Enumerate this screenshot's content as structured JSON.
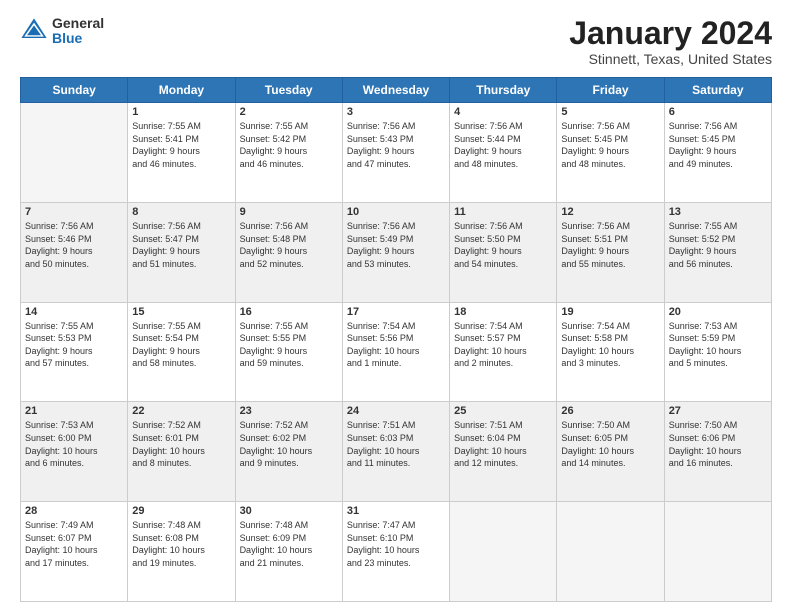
{
  "logo": {
    "general": "General",
    "blue": "Blue"
  },
  "title": "January 2024",
  "subtitle": "Stinnett, Texas, United States",
  "days_header": [
    "Sunday",
    "Monday",
    "Tuesday",
    "Wednesday",
    "Thursday",
    "Friday",
    "Saturday"
  ],
  "weeks": [
    [
      {
        "num": "",
        "empty": true
      },
      {
        "num": "1",
        "sunrise": "Sunrise: 7:55 AM",
        "sunset": "Sunset: 5:41 PM",
        "daylight": "Daylight: 9 hours and 46 minutes."
      },
      {
        "num": "2",
        "sunrise": "Sunrise: 7:55 AM",
        "sunset": "Sunset: 5:42 PM",
        "daylight": "Daylight: 9 hours and 46 minutes."
      },
      {
        "num": "3",
        "sunrise": "Sunrise: 7:56 AM",
        "sunset": "Sunset: 5:43 PM",
        "daylight": "Daylight: 9 hours and 47 minutes."
      },
      {
        "num": "4",
        "sunrise": "Sunrise: 7:56 AM",
        "sunset": "Sunset: 5:44 PM",
        "daylight": "Daylight: 9 hours and 48 minutes."
      },
      {
        "num": "5",
        "sunrise": "Sunrise: 7:56 AM",
        "sunset": "Sunset: 5:45 PM",
        "daylight": "Daylight: 9 hours and 48 minutes."
      },
      {
        "num": "6",
        "sunrise": "Sunrise: 7:56 AM",
        "sunset": "Sunset: 5:45 PM",
        "daylight": "Daylight: 9 hours and 49 minutes."
      }
    ],
    [
      {
        "num": "7",
        "sunrise": "Sunrise: 7:56 AM",
        "sunset": "Sunset: 5:46 PM",
        "daylight": "Daylight: 9 hours and 50 minutes."
      },
      {
        "num": "8",
        "sunrise": "Sunrise: 7:56 AM",
        "sunset": "Sunset: 5:47 PM",
        "daylight": "Daylight: 9 hours and 51 minutes."
      },
      {
        "num": "9",
        "sunrise": "Sunrise: 7:56 AM",
        "sunset": "Sunset: 5:48 PM",
        "daylight": "Daylight: 9 hours and 52 minutes."
      },
      {
        "num": "10",
        "sunrise": "Sunrise: 7:56 AM",
        "sunset": "Sunset: 5:49 PM",
        "daylight": "Daylight: 9 hours and 53 minutes."
      },
      {
        "num": "11",
        "sunrise": "Sunrise: 7:56 AM",
        "sunset": "Sunset: 5:50 PM",
        "daylight": "Daylight: 9 hours and 54 minutes."
      },
      {
        "num": "12",
        "sunrise": "Sunrise: 7:56 AM",
        "sunset": "Sunset: 5:51 PM",
        "daylight": "Daylight: 9 hours and 55 minutes."
      },
      {
        "num": "13",
        "sunrise": "Sunrise: 7:55 AM",
        "sunset": "Sunset: 5:52 PM",
        "daylight": "Daylight: 9 hours and 56 minutes."
      }
    ],
    [
      {
        "num": "14",
        "sunrise": "Sunrise: 7:55 AM",
        "sunset": "Sunset: 5:53 PM",
        "daylight": "Daylight: 9 hours and 57 minutes."
      },
      {
        "num": "15",
        "sunrise": "Sunrise: 7:55 AM",
        "sunset": "Sunset: 5:54 PM",
        "daylight": "Daylight: 9 hours and 58 minutes."
      },
      {
        "num": "16",
        "sunrise": "Sunrise: 7:55 AM",
        "sunset": "Sunset: 5:55 PM",
        "daylight": "Daylight: 9 hours and 59 minutes."
      },
      {
        "num": "17",
        "sunrise": "Sunrise: 7:54 AM",
        "sunset": "Sunset: 5:56 PM",
        "daylight": "Daylight: 10 hours and 1 minute."
      },
      {
        "num": "18",
        "sunrise": "Sunrise: 7:54 AM",
        "sunset": "Sunset: 5:57 PM",
        "daylight": "Daylight: 10 hours and 2 minutes."
      },
      {
        "num": "19",
        "sunrise": "Sunrise: 7:54 AM",
        "sunset": "Sunset: 5:58 PM",
        "daylight": "Daylight: 10 hours and 3 minutes."
      },
      {
        "num": "20",
        "sunrise": "Sunrise: 7:53 AM",
        "sunset": "Sunset: 5:59 PM",
        "daylight": "Daylight: 10 hours and 5 minutes."
      }
    ],
    [
      {
        "num": "21",
        "sunrise": "Sunrise: 7:53 AM",
        "sunset": "Sunset: 6:00 PM",
        "daylight": "Daylight: 10 hours and 6 minutes."
      },
      {
        "num": "22",
        "sunrise": "Sunrise: 7:52 AM",
        "sunset": "Sunset: 6:01 PM",
        "daylight": "Daylight: 10 hours and 8 minutes."
      },
      {
        "num": "23",
        "sunrise": "Sunrise: 7:52 AM",
        "sunset": "Sunset: 6:02 PM",
        "daylight": "Daylight: 10 hours and 9 minutes."
      },
      {
        "num": "24",
        "sunrise": "Sunrise: 7:51 AM",
        "sunset": "Sunset: 6:03 PM",
        "daylight": "Daylight: 10 hours and 11 minutes."
      },
      {
        "num": "25",
        "sunrise": "Sunrise: 7:51 AM",
        "sunset": "Sunset: 6:04 PM",
        "daylight": "Daylight: 10 hours and 12 minutes."
      },
      {
        "num": "26",
        "sunrise": "Sunrise: 7:50 AM",
        "sunset": "Sunset: 6:05 PM",
        "daylight": "Daylight: 10 hours and 14 minutes."
      },
      {
        "num": "27",
        "sunrise": "Sunrise: 7:50 AM",
        "sunset": "Sunset: 6:06 PM",
        "daylight": "Daylight: 10 hours and 16 minutes."
      }
    ],
    [
      {
        "num": "28",
        "sunrise": "Sunrise: 7:49 AM",
        "sunset": "Sunset: 6:07 PM",
        "daylight": "Daylight: 10 hours and 17 minutes."
      },
      {
        "num": "29",
        "sunrise": "Sunrise: 7:48 AM",
        "sunset": "Sunset: 6:08 PM",
        "daylight": "Daylight: 10 hours and 19 minutes."
      },
      {
        "num": "30",
        "sunrise": "Sunrise: 7:48 AM",
        "sunset": "Sunset: 6:09 PM",
        "daylight": "Daylight: 10 hours and 21 minutes."
      },
      {
        "num": "31",
        "sunrise": "Sunrise: 7:47 AM",
        "sunset": "Sunset: 6:10 PM",
        "daylight": "Daylight: 10 hours and 23 minutes."
      },
      {
        "num": "",
        "empty": true
      },
      {
        "num": "",
        "empty": true
      },
      {
        "num": "",
        "empty": true
      }
    ]
  ]
}
